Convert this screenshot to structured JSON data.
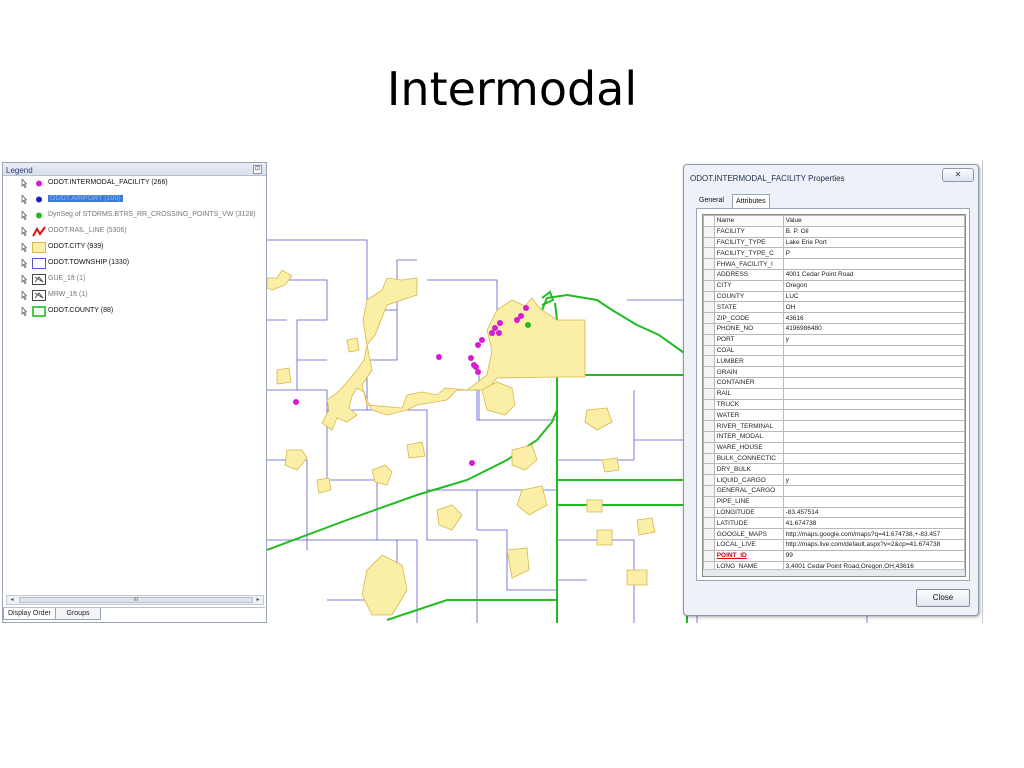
{
  "slide": {
    "title": "Intermodal"
  },
  "legend": {
    "title": "Legend",
    "pin_glyph": "⊡",
    "items": [
      {
        "label": "ODOT.INTERMODAL_FACILITY  (266)",
        "symbol": "magenta-dot",
        "color": "#d61ad6",
        "style": "normal"
      },
      {
        "label": "ODOT.AIRPORT  (100)",
        "symbol": "blue-dot",
        "color": "#1a1ad6",
        "style": "selected"
      },
      {
        "label": "DynSeg of STORMS.BTRS_RR_CROSSING_POINTS_VW (3128)",
        "symbol": "green-dot",
        "color": "#22bb22",
        "style": "faded"
      },
      {
        "label": "ODOT.RAIL_LINE  (5306)",
        "symbol": "red-line",
        "color": "#e01010",
        "style": "faded"
      },
      {
        "label": "ODOT.CITY  (939)",
        "symbol": "yellow-fill",
        "color": "#fbeea6",
        "style": "normal"
      },
      {
        "label": "ODOT.TOWNSHIP  (1330)",
        "symbol": "blue-outline",
        "color": "#5a5ad0",
        "style": "normal"
      },
      {
        "label": "GUE_1ft  (1)",
        "symbol": "raster",
        "color": "#444444",
        "style": "faded"
      },
      {
        "label": "MRW_1ft  (1)",
        "symbol": "raster",
        "color": "#444444",
        "style": "faded"
      },
      {
        "label": "ODOT.COUNTY  (88)",
        "symbol": "green-outline",
        "color": "#22bb22",
        "style": "normal"
      }
    ],
    "scroll_thumb_text": "III",
    "tabs": [
      "Display Order",
      "Groups"
    ]
  },
  "dialog": {
    "title": "ODOT.INTERMODAL_FACILITY Properties",
    "close_glyph": "✕",
    "tabs": [
      "General",
      "Attributes"
    ],
    "table_header": {
      "name": "Name",
      "value": "Value"
    },
    "attributes": [
      {
        "name": "FACILITY",
        "value": "B. P. Oil"
      },
      {
        "name": "FACILITY_TYPE",
        "value": "Lake Erie Port"
      },
      {
        "name": "FACILITY_TYPE_C",
        "value": "P"
      },
      {
        "name": "FHWA_FACILITY_I",
        "value": ""
      },
      {
        "name": "ADDRESS",
        "value": "4001 Cedar Point Road"
      },
      {
        "name": "CITY",
        "value": "Oregon"
      },
      {
        "name": "COUNTY",
        "value": "LUC"
      },
      {
        "name": "STATE",
        "value": "OH"
      },
      {
        "name": "ZIP_CODE",
        "value": "43616"
      },
      {
        "name": "PHONE_NO",
        "value": "4196986480"
      },
      {
        "name": "PORT",
        "value": "y"
      },
      {
        "name": "COAL",
        "value": ""
      },
      {
        "name": "LUMBER",
        "value": ""
      },
      {
        "name": "GRAIN",
        "value": ""
      },
      {
        "name": "CONTAINER",
        "value": ""
      },
      {
        "name": "RAIL",
        "value": ""
      },
      {
        "name": "TRUCK",
        "value": ""
      },
      {
        "name": "WATER",
        "value": ""
      },
      {
        "name": "RIVER_TERMINAL",
        "value": ""
      },
      {
        "name": "INTER_MODAL",
        "value": ""
      },
      {
        "name": "WARE_HOUSE",
        "value": ""
      },
      {
        "name": "BULK_CONNECTIC",
        "value": ""
      },
      {
        "name": "DRY_BULK",
        "value": ""
      },
      {
        "name": "LIQUID_CARGO",
        "value": "y"
      },
      {
        "name": "GENERAL_CARGO",
        "value": ""
      },
      {
        "name": "PIPE_LINE",
        "value": ""
      },
      {
        "name": "LONGITUDE",
        "value": "-83.457514"
      },
      {
        "name": "LATITUDE",
        "value": "41.674738"
      },
      {
        "name": "GOOGLE_MAPS",
        "value": "http://maps.google.com/maps?q=41.674738,+-83.457"
      },
      {
        "name": "LOCAL_LIVE",
        "value": "http://maps.live.com/default.aspx?v=2&cp=41.674738"
      },
      {
        "name": "POINT_ID",
        "value": "99",
        "highlight": true
      },
      {
        "name": "LONG_NAME",
        "value": "3,4001 Cedar Point Road,Oregon,OH,43616"
      }
    ],
    "close_button": "Close"
  },
  "colors": {
    "city_fill": "#fbeea6",
    "city_stroke": "#d8b84a",
    "township": "#5a5ad0",
    "county": "#22bb22",
    "facility": "#d61ad6"
  }
}
